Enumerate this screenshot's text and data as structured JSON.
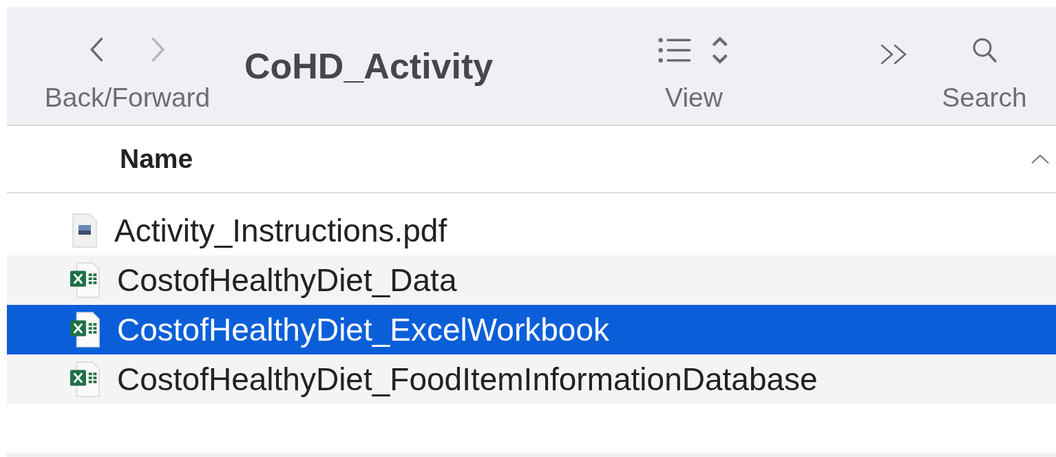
{
  "toolbar": {
    "title": "CoHD_Activity",
    "nav_label": "Back/Forward",
    "view_label": "View",
    "search_label": "Search"
  },
  "table": {
    "columns": [
      {
        "label": "Name",
        "sort_ascending": true
      }
    ],
    "rows": [
      {
        "name": "Activity_Instructions.pdf",
        "kind": "pdf",
        "selected": false
      },
      {
        "name": "CostofHealthyDiet_Data",
        "kind": "excel",
        "selected": false
      },
      {
        "name": "CostofHealthyDiet_ExcelWorkbook",
        "kind": "excel",
        "selected": true
      },
      {
        "name": "CostofHealthyDiet_FoodItemInformationDatabase",
        "kind": "excel",
        "selected": false
      }
    ]
  }
}
